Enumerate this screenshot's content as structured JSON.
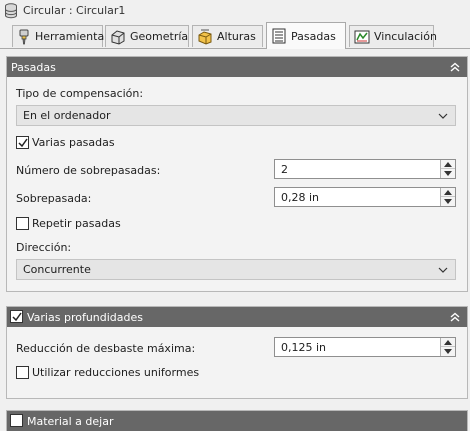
{
  "window": {
    "title": "Circular : Circular1"
  },
  "tabs": [
    {
      "label": "Herramienta",
      "active": false
    },
    {
      "label": "Geometría",
      "active": false
    },
    {
      "label": "Alturas",
      "active": false
    },
    {
      "label": "Pasadas",
      "active": true
    },
    {
      "label": "Vinculación",
      "active": false
    }
  ],
  "pasadas": {
    "header": "Pasadas",
    "comp_label": "Tipo de compensación:",
    "comp_value": "En el ordenador",
    "varias_pasadas_label": "Varias pasadas",
    "varias_pasadas_checked": true,
    "num_sobre_label": "Número de sobrepasadas:",
    "num_sobre_value": "2",
    "sobre_label": "Sobrepasada:",
    "sobre_value": "0,28 in",
    "repetir_label": "Repetir pasadas",
    "repetir_checked": false,
    "direccion_label": "Dirección:",
    "direccion_value": "Concurrente"
  },
  "profundidades": {
    "header": "Varias profundidades",
    "header_checked": true,
    "reduccion_label": "Reducción de desbaste máxima:",
    "reduccion_value": "0,125 in",
    "uniformes_label": "Utilizar reducciones uniformes",
    "uniformes_checked": false
  },
  "material": {
    "header": "Material a dejar",
    "header_checked": false
  },
  "colors": {
    "section_header": "#676767",
    "panel_bg": "#f3f3f3",
    "page_bg": "#f0f0f0"
  },
  "icons": [
    "database-icon",
    "tool-icon",
    "geometry-icon",
    "heights-icon",
    "passes-icon",
    "linking-icon",
    "collapse-chevron-icon",
    "dropdown-chevron-icon",
    "spin-up-icon",
    "spin-down-icon",
    "checkmark-icon"
  ]
}
